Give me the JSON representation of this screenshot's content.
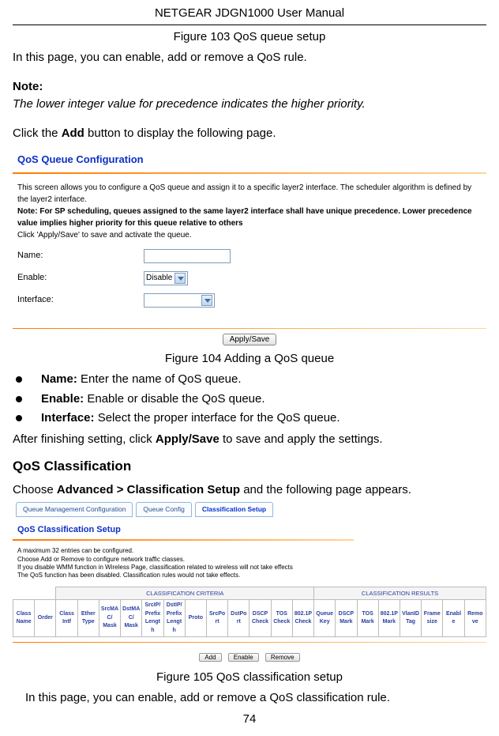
{
  "header": "NETGEAR JDGN1000 User Manual",
  "figure103": "Figure 103 QoS queue setup",
  "introLine": "In this page, you can enable, add or remove a QoS rule.",
  "note": {
    "label": "Note:",
    "text": "The lower integer value for precedence indicates the higher priority."
  },
  "instr1_pre": "Click the ",
  "instr1_bold": "Add",
  "instr1_post": " button to display the following page.",
  "shot1": {
    "title": "QoS Queue Configuration",
    "desc_line1": "This screen allows you to configure a QoS queue and assign it to a specific layer2 interface. The scheduler algorithm is defined by the layer2 interface.",
    "desc_bold": "Note: For SP scheduling, queues assigned to the same layer2 interface shall have unique precedence. Lower precedence value implies higher priority for this queue relative to others",
    "desc_line3": "Click 'Apply/Save' to save and activate the queue.",
    "labels": {
      "name": "Name:",
      "enable": "Enable:",
      "interface": "Interface:"
    },
    "enable_value": "Disable",
    "button": "Apply/Save"
  },
  "figure104": "Figure 104 Adding a QoS queue",
  "bullets": [
    {
      "b": "Name:",
      "t": " Enter the name of QoS queue."
    },
    {
      "b": "Enable:",
      "t": " Enable or disable the QoS queue."
    },
    {
      "b": "Interface:",
      "t": " Select the proper interface for the QoS queue."
    }
  ],
  "after_pre": "After finishing setting, click ",
  "after_bold": "Apply/Save",
  "after_post": " to save and apply the settings.",
  "h2": "QoS Classification",
  "choose_pre": "Choose ",
  "choose_bold": "Advanced > Classification Setup",
  "choose_post": " and the following page appears.",
  "shot2": {
    "tabs": [
      "Queue Management Configuration",
      "Queue Config",
      "Classification Setup"
    ],
    "title": "QoS Classification Setup",
    "desc1": "A maximum 32 entries can be configured.",
    "desc2": "Choose Add or Remove to configure network traffic classes.",
    "desc3": "If you disable WMM function in Wireless Page, classification related to wireless will not take effects",
    "desc4": "The QoS function has been disabled. Classification rules would not take effects.",
    "group_criteria": "CLASSIFICATION CRITERIA",
    "group_results": "CLASSIFICATION RESULTS",
    "cols": [
      "Class Name",
      "Order",
      "Class Intf",
      "Ether Type",
      "SrcMAC/ Mask",
      "DstMAC/ Mask",
      "SrcIP/ PrefixLength",
      "DstIP/ PrefixLength",
      "Proto",
      "SrcPort",
      "DstPort",
      "DSCP Check",
      "TOS Check",
      "802.1P Check",
      "Queue Key",
      "DSCP Mark",
      "TOS Mark",
      "802.1P Mark",
      "VlanID Tag",
      "Frame size",
      "Enable",
      "Remove"
    ],
    "buttons": [
      "Add",
      "Enable",
      "Remove"
    ]
  },
  "figure105": "Figure 105 QoS classification setup",
  "lastLine": "In this page, you can enable, add or remove a QoS classification rule.",
  "pageNumber": "74"
}
